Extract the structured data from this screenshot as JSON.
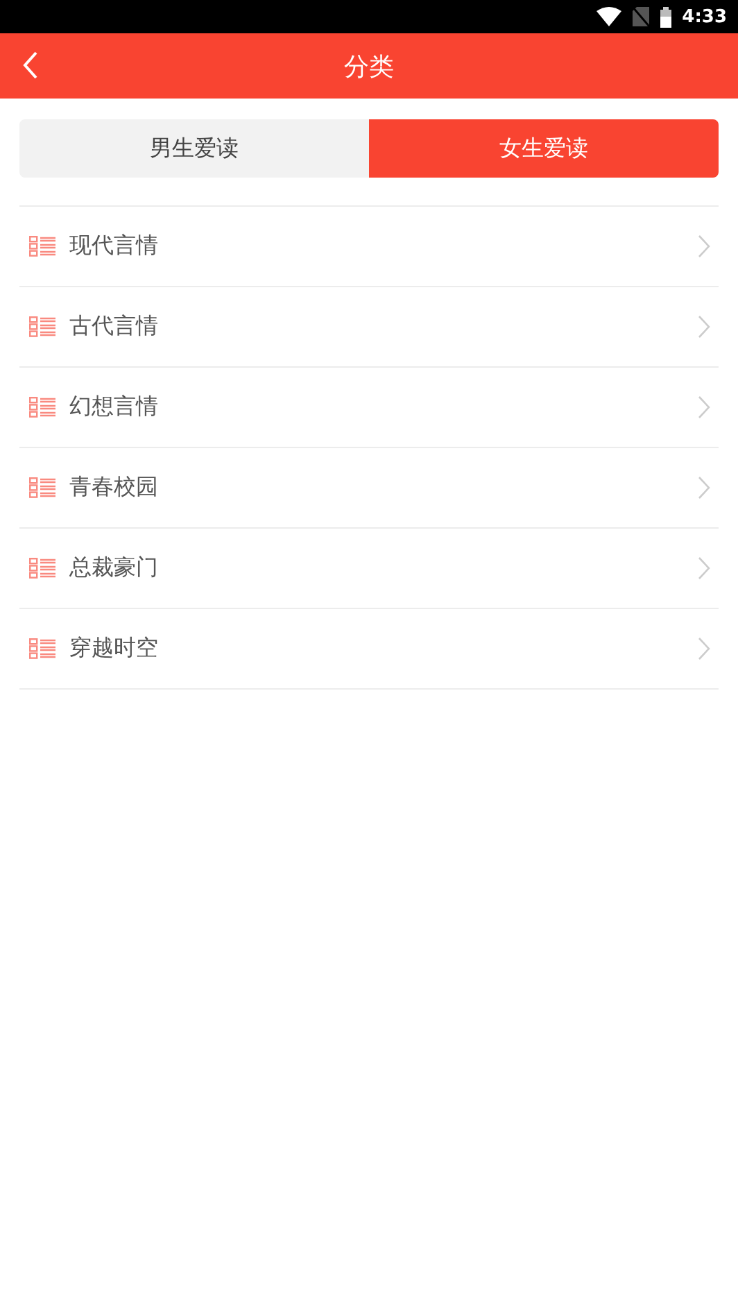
{
  "status_bar": {
    "time": "4:33"
  },
  "header": {
    "title": "分类"
  },
  "tabs": [
    {
      "label": "男生爱读",
      "selected": false
    },
    {
      "label": "女生爱读",
      "selected": true
    }
  ],
  "categories": [
    {
      "label": "现代言情"
    },
    {
      "label": "古代言情"
    },
    {
      "label": "幻想言情"
    },
    {
      "label": "青春校园"
    },
    {
      "label": "总裁豪门"
    },
    {
      "label": "穿越时空"
    }
  ]
}
